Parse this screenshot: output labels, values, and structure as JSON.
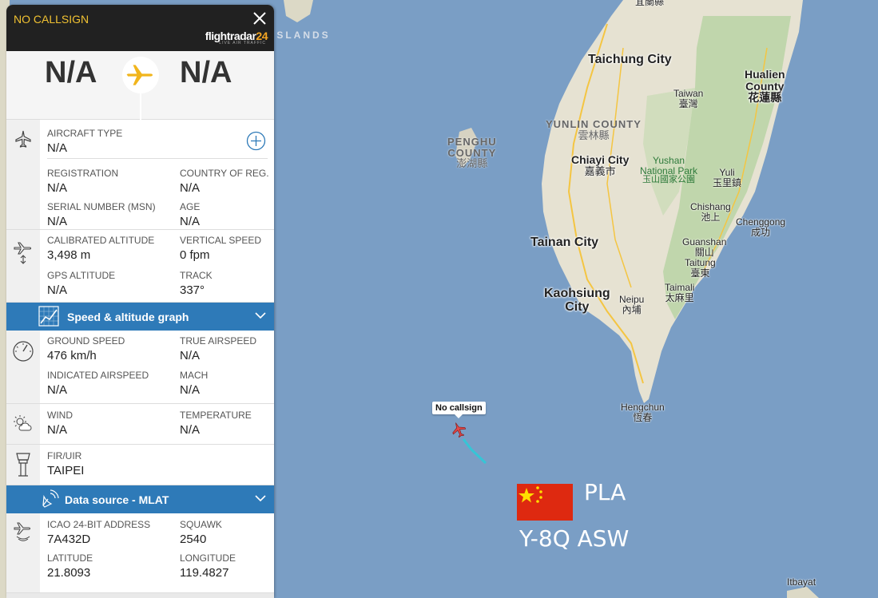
{
  "map": {
    "labels": {
      "taichung": "Taichung City",
      "hualien_en": "Hualien",
      "hualien_en2": "County",
      "hualien_zh": "花蓮縣",
      "taiwan_en": "Taiwan",
      "taiwan_zh": "臺灣",
      "yunlin_en": "YUNLIN COUNTY",
      "yunlin_zh": "雲林縣",
      "penghu_en": "PENGHU",
      "penghu_en2": "COUNTY",
      "penghu_zh": "澎湖縣",
      "chiayi_en": "Chiayi City",
      "chiayi_zh": "嘉義市",
      "yushan_en": "Yushan",
      "yushan_en2": "National Park",
      "yushan_zh": "玉山國家公園",
      "yuli_en": "Yuli",
      "yuli_zh": "玉里鎮",
      "chishang_en": "Chishang",
      "chishang_zh": "池上",
      "chenggong_en": "Chenggong",
      "chenggong_zh": "成功",
      "tainan": "Tainan City",
      "guanshan_en": "Guanshan",
      "guanshan_zh": "關山",
      "taitung_en": "Taitung",
      "taitung_zh": "臺東",
      "taimali_en": "Taimali",
      "taimali_zh": "太麻里",
      "kaohsiung": "Kaohsiung",
      "kaohsiung2": "City",
      "neipu_en": "Neipu",
      "neipu_zh": "內埔",
      "hengchun_en": "Hengchun",
      "hengchun_zh": "恆春",
      "itbayat": "Itbayat",
      "islands": "ISLANDS",
      "top_zh": "宜蘭縣"
    },
    "callsign_tag": "No callsign",
    "overlay_operator": "PLA",
    "overlay_type": "Y-8Q ASW",
    "colors": {
      "sea": "#7a9ec5",
      "land": "#e8e4d8",
      "trail": "#36c5d6",
      "flag": "#de2910"
    }
  },
  "panel": {
    "callsign": "NO CALLSIGN",
    "logo_text": "flightradar",
    "logo_num": "24",
    "logo_sub": "LIVE AIR TRAFFIC",
    "origin": "N/A",
    "destination": "N/A",
    "aircraft_type_label": "AIRCRAFT TYPE",
    "aircraft_type": "N/A",
    "registration_label": "REGISTRATION",
    "registration": "N/A",
    "country_label": "COUNTRY OF REG.",
    "country": "N/A",
    "msn_label": "SERIAL NUMBER (MSN)",
    "msn": "N/A",
    "age_label": "AGE",
    "age": "N/A",
    "cal_alt_label": "CALIBRATED ALTITUDE",
    "cal_alt": "3,498 m",
    "vspeed_label": "VERTICAL SPEED",
    "vspeed": "0 fpm",
    "gps_alt_label": "GPS ALTITUDE",
    "gps_alt": "N/A",
    "track_label": "TRACK",
    "track": "337°",
    "graph_bar": "Speed & altitude graph",
    "gs_label": "GROUND SPEED",
    "gs": "476 km/h",
    "tas_label": "TRUE AIRSPEED",
    "tas": "N/A",
    "ias_label": "INDICATED AIRSPEED",
    "ias": "N/A",
    "mach_label": "MACH",
    "mach": "N/A",
    "wind_label": "WIND",
    "wind": "N/A",
    "temp_label": "TEMPERATURE",
    "temp": "N/A",
    "fir_label": "FIR/UIR",
    "fir": "TAIPEI",
    "source_bar": "Data source - MLAT",
    "icao_label": "ICAO 24-BIT ADDRESS",
    "icao": "7A432D",
    "squawk_label": "SQUAWK",
    "squawk": "2540",
    "lat_label": "LATITUDE",
    "lat": "21.8093",
    "lon_label": "LONGITUDE",
    "lon": "119.4827"
  }
}
